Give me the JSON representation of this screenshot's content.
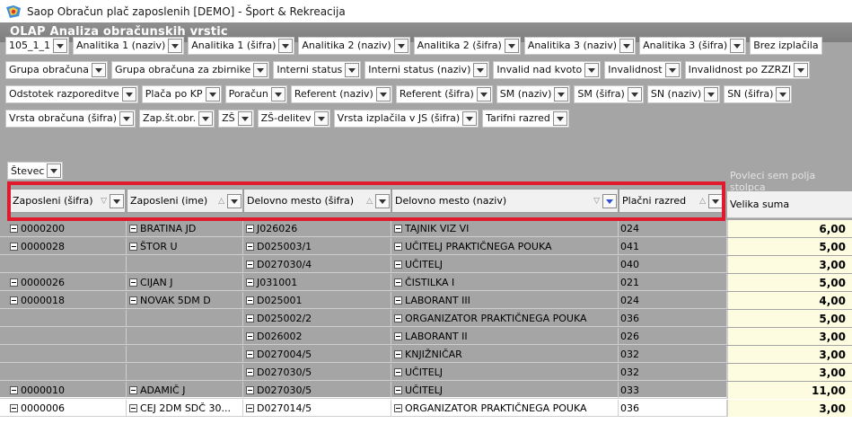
{
  "window": {
    "title": "Saop Obračun plač zaposlenih [DEMO] - Šport & Rekreacija",
    "app_icon": "app-icon"
  },
  "olap": {
    "title": "OLAP Analiza obračunskih vrstic"
  },
  "filter_rows": [
    [
      "105_1_1",
      "Analitika 1 (naziv)",
      "Analitika 1 (šifra)",
      "Analitika 2 (naziv)",
      "Analitika 2 (šifra)",
      "Analitika 3 (naziv)",
      "Analitika 3 (šifra)",
      "Brez izplačila"
    ],
    [
      "Grupa obračuna",
      "Grupa obračuna za zbirnike",
      "Interni status",
      "Interni status (naziv)",
      "Invalid nad kvoto",
      "Invalidnost",
      "Invalidnost po ZZRZI"
    ],
    [
      "Odstotek razporeditve",
      "Plača po KP",
      "Poračun",
      "Referent (naziv)",
      "Referent (šifra)",
      "SM (naziv)",
      "SM (šifra)",
      "SN (naziv)",
      "SN (šifra)"
    ],
    [
      "Vrsta obračuna (šifra)",
      "Zap.št.obr.",
      "ZŠ",
      "ZŠ-delitev",
      "Vrsta izplačila v JS (šifra)",
      "Tarifni razred"
    ]
  ],
  "data_field": {
    "label": "Števec"
  },
  "hint": "Povleci sem polja stolpca",
  "row_headers": [
    {
      "label": "Zaposleni (šifra)",
      "sort": "▽"
    },
    {
      "label": "Zaposleni (ime)",
      "sort": "△"
    },
    {
      "label": "Delovno mesto (šifra)",
      "sort": "△"
    },
    {
      "label": "Delovno mesto (naziv)",
      "sort": "▽"
    },
    {
      "label": "Plačni razred",
      "sort": "△"
    }
  ],
  "value_header": "Velika suma",
  "rows": [
    {
      "emp_id": "0000200",
      "emp_name": "BRATINA JD",
      "job_id": "J026026",
      "job_name": "TAJNIK VIZ VI",
      "grade": "024",
      "value": "6,00"
    },
    {
      "emp_id": "0000028",
      "emp_name": "ŠTOR U",
      "job_id": "D025003/1",
      "job_name": "UČITELJ PRAKTIČNEGA POUKA",
      "grade": "041",
      "value": "5,00"
    },
    {
      "emp_id": "",
      "emp_name": "",
      "job_id": "D027030/4",
      "job_name": "UČITELJ",
      "grade": "040",
      "value": "3,00"
    },
    {
      "emp_id": "0000026",
      "emp_name": "CIJAN J",
      "job_id": "J031001",
      "job_name": "ČISTILKA I",
      "grade": "021",
      "value": "5,00"
    },
    {
      "emp_id": "0000018",
      "emp_name": "NOVAK 5DM D",
      "job_id": "D025001",
      "job_name": "LABORANT III",
      "grade": "024",
      "value": "4,00"
    },
    {
      "emp_id": "",
      "emp_name": "",
      "job_id": "D025002/2",
      "job_name": "ORGANIZATOR PRAKTIČNEGA POUKA",
      "grade": "036",
      "value": "5,00"
    },
    {
      "emp_id": "",
      "emp_name": "",
      "job_id": "D026002",
      "job_name": "LABORANT II",
      "grade": "026",
      "value": "3,00"
    },
    {
      "emp_id": "",
      "emp_name": "",
      "job_id": "D027004/5",
      "job_name": "KNJIŽNIČAR",
      "grade": "032",
      "value": "3,00"
    },
    {
      "emp_id": "",
      "emp_name": "",
      "job_id": "D027030/5",
      "job_name": "UČITELJ",
      "grade": "032",
      "value": "3,00"
    },
    {
      "emp_id": "0000010",
      "emp_name": "ADAMIČ J",
      "job_id": "D027030/5",
      "job_name": "UČITELJ",
      "grade": "033",
      "value": "11,00"
    },
    {
      "emp_id": "0000006",
      "emp_name": "CEJ 2DM SDČ 30...",
      "job_id": "D027014/5",
      "job_name": "ORGANIZATOR PRAKTIČNEGA POUKA",
      "grade": "036",
      "value": "3,00"
    }
  ],
  "colors": {
    "title_bar": "#858585",
    "panel": "#a5a5a5",
    "highlight_border": "#e01a2c",
    "value_bg": "#fdfce1"
  }
}
